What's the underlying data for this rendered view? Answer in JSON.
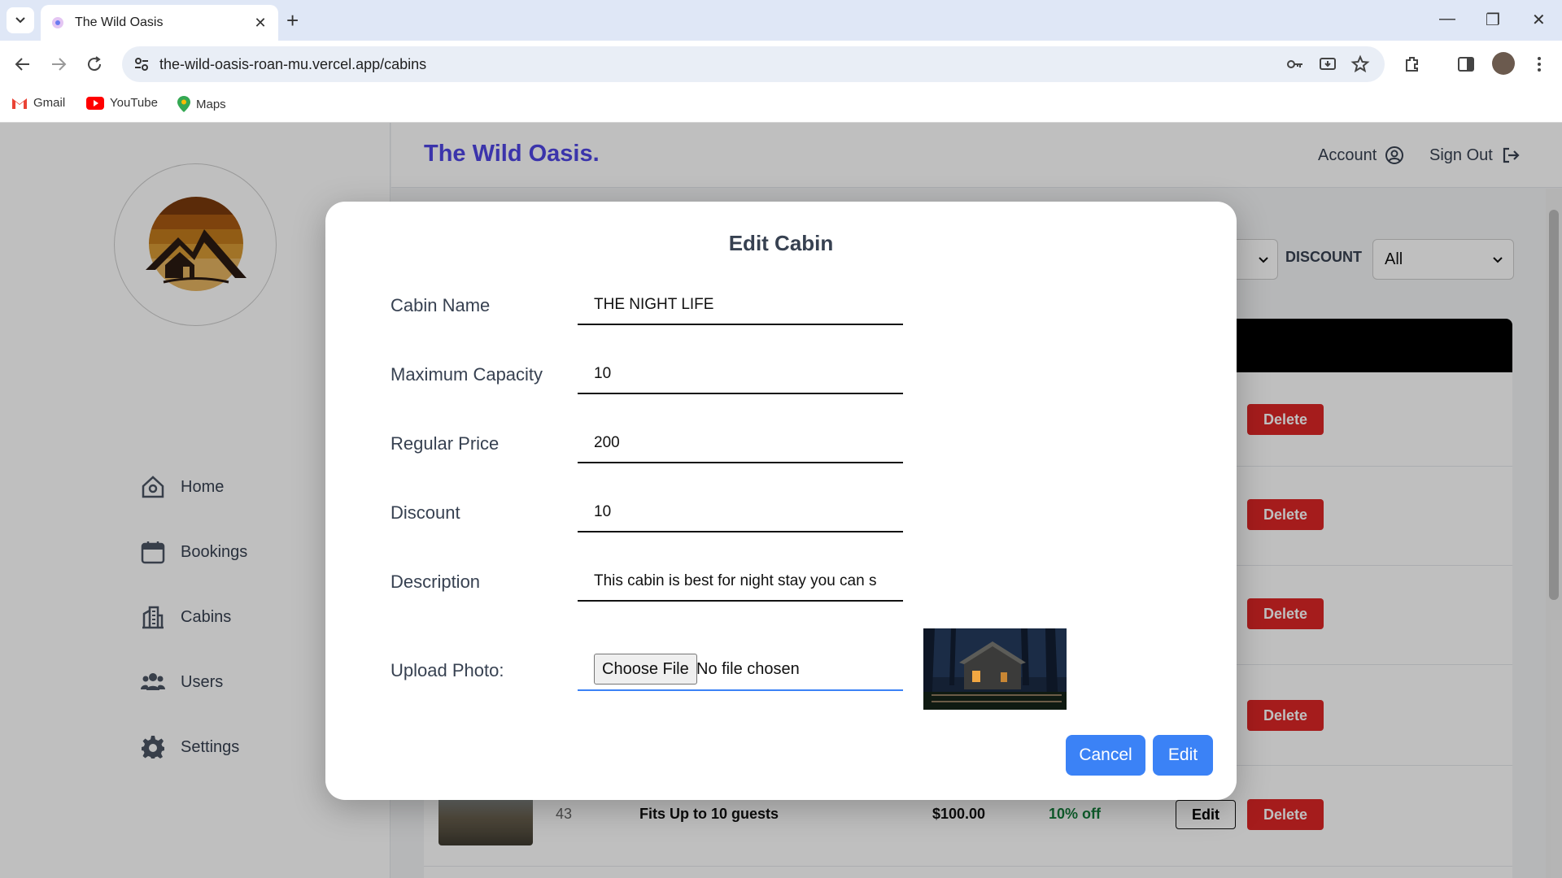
{
  "browser": {
    "tab_title": "The Wild Oasis",
    "url": "the-wild-oasis-roan-mu.vercel.app/cabins",
    "bookmarks": [
      {
        "label": "Gmail",
        "icon": "gmail-icon"
      },
      {
        "label": "YouTube",
        "icon": "youtube-icon"
      },
      {
        "label": "Maps",
        "icon": "maps-icon"
      }
    ]
  },
  "app": {
    "brand": "The Wild Oasis.",
    "header": {
      "account": "Account",
      "sign_out": "Sign Out"
    },
    "nav": [
      {
        "label": "Home",
        "icon": "home-icon"
      },
      {
        "label": "Bookings",
        "icon": "calendar-icon"
      },
      {
        "label": "Cabins",
        "icon": "building-icon"
      },
      {
        "label": "Users",
        "icon": "users-icon"
      },
      {
        "label": "Settings",
        "icon": "gear-icon"
      }
    ],
    "filters": {
      "discount_label": "DISCOUNT",
      "discount_value": "All"
    },
    "table": {
      "edit_label": "Edit",
      "delete_label": "Delete",
      "visible_row": {
        "number": "43",
        "capacity": "Fits Up to 10 guests",
        "price": "$100.00",
        "discount": "10% off"
      }
    }
  },
  "modal": {
    "title": "Edit Cabin",
    "fields": {
      "name_label": "Cabin Name",
      "name_value": "THE NIGHT LIFE",
      "capacity_label": "Maximum Capacity",
      "capacity_value": "10",
      "price_label": "Regular Price",
      "price_value": "200",
      "discount_label": "Discount",
      "discount_value": "10",
      "description_label": "Description",
      "description_value": "This cabin is best for night stay you can s",
      "photo_label": "Upload Photo:",
      "choose_file": "Choose File",
      "no_file": "No file chosen"
    },
    "cancel": "Cancel",
    "submit": "Edit"
  },
  "colors": {
    "brand": "#4f46e5",
    "primary": "#3b82f6",
    "danger": "#dc2626",
    "success": "#15803d"
  }
}
